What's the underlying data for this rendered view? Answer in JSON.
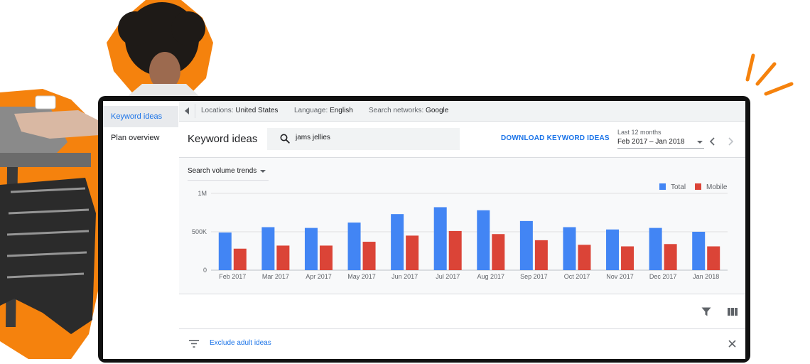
{
  "sidebar": {
    "items": [
      {
        "label": "Keyword ideas",
        "active": true
      },
      {
        "label": "Plan overview",
        "active": false
      }
    ]
  },
  "filterbar": {
    "location_label": "Locations:",
    "location_value": "United States",
    "language_label": "Language:",
    "language_value": "English",
    "networks_label": "Search networks:",
    "networks_value": "Google"
  },
  "header": {
    "title": "Keyword ideas",
    "search_value": "jams jellies",
    "download_label": "DOWNLOAD KEYWORD IDEAS",
    "range_label": "Last 12 months",
    "range_value": "Feb 2017 – Jan 2018"
  },
  "chart_controls": {
    "trend_select": "Search volume trends"
  },
  "chart_data": {
    "type": "bar",
    "categories": [
      "Feb 2017",
      "Mar 2017",
      "Apr 2017",
      "May 2017",
      "Jun 2017",
      "Jul 2017",
      "Aug 2017",
      "Sep 2017",
      "Oct 2017",
      "Nov 2017",
      "Dec 2017",
      "Jan 2018"
    ],
    "series": [
      {
        "name": "Total",
        "color": "#4285f4",
        "values": [
          490000,
          560000,
          550000,
          620000,
          730000,
          820000,
          780000,
          640000,
          560000,
          530000,
          550000,
          500000
        ]
      },
      {
        "name": "Mobile",
        "color": "#db4437",
        "values": [
          280000,
          320000,
          320000,
          370000,
          450000,
          510000,
          470000,
          390000,
          330000,
          310000,
          340000,
          310000
        ]
      }
    ],
    "ylim": [
      0,
      1000000
    ],
    "yticks": [
      {
        "value": 0,
        "label": "0"
      },
      {
        "value": 500000,
        "label": "500K"
      },
      {
        "value": 1000000,
        "label": "1M"
      }
    ],
    "legend_position": "top-right",
    "grid": true
  },
  "exclude": {
    "label": "Exclude adult ideas"
  },
  "colors": {
    "accent": "#1a73e8",
    "total": "#4285f4",
    "mobile": "#db4437",
    "orange": "#f5820d"
  },
  "icons": {
    "collapse": "chevron-left-icon",
    "search": "search-icon",
    "prev": "chevron-left-icon",
    "next": "chevron-right-icon",
    "filter": "funnel-icon",
    "columns": "columns-icon",
    "filter_lines": "filter-list-icon",
    "close": "close-icon"
  }
}
